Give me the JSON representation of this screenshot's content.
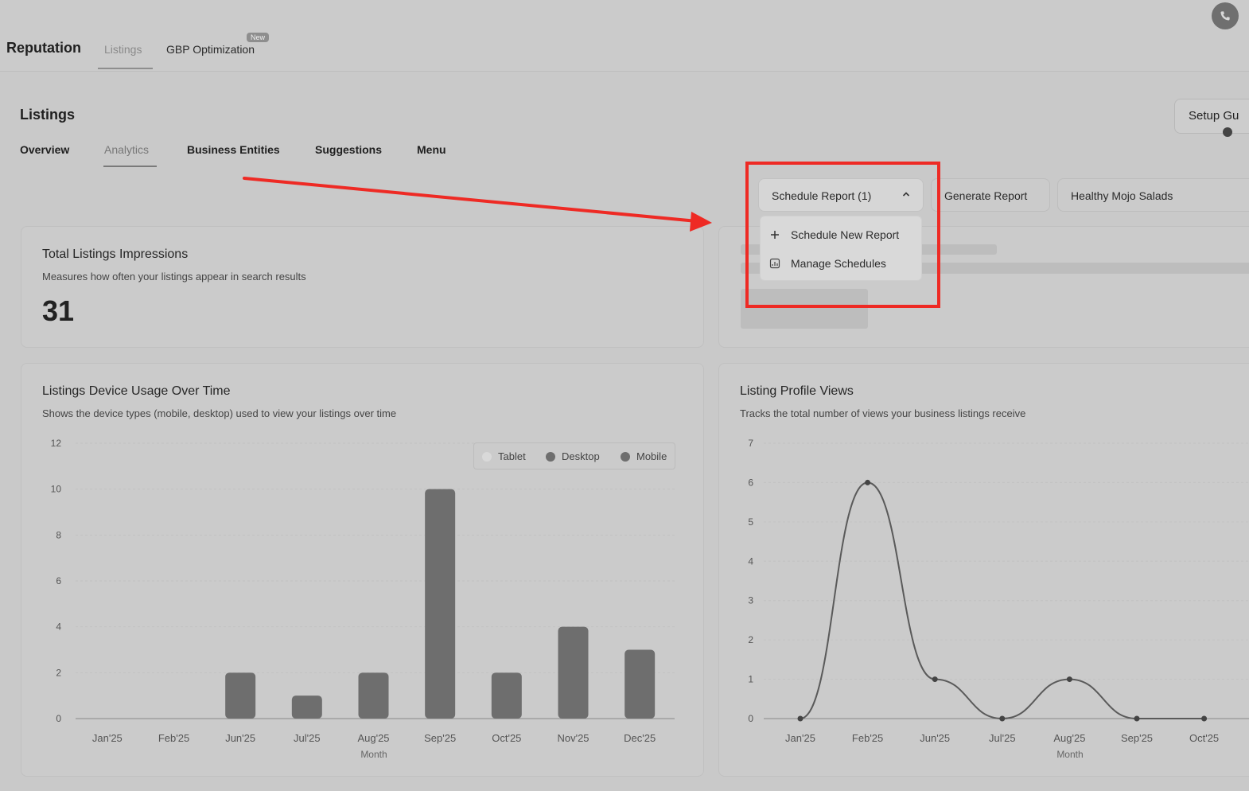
{
  "header": {
    "app_title": "Reputation",
    "tabs": [
      {
        "label": "Listings",
        "active": true
      },
      {
        "label": "GBP Optimization",
        "badge": "New"
      }
    ]
  },
  "page": {
    "title": "Listings",
    "setup_guide_label": "Setup Gu",
    "sub_tabs": [
      {
        "label": "Overview"
      },
      {
        "label": "Analytics",
        "active": true
      },
      {
        "label": "Business Entities"
      },
      {
        "label": "Suggestions"
      },
      {
        "label": "Menu"
      }
    ]
  },
  "toolbar": {
    "schedule_label": "Schedule Report (1)",
    "generate_label": "Generate Report",
    "location_value": "Healthy Mojo Salads"
  },
  "dropdown": {
    "items": [
      {
        "label": "Schedule New Report",
        "icon": "plus-icon"
      },
      {
        "label": "Manage Schedules",
        "icon": "calendar-report-icon"
      }
    ]
  },
  "impressions": {
    "title": "Total Listings Impressions",
    "subtitle": "Measures how often your listings appear in search results",
    "value": "31"
  },
  "colors": {
    "highlight": "#ee2a24",
    "bar": "#6e6e6e",
    "line": "#5a5a5a",
    "tablet": "#d9d9d9",
    "desktop": "#6e6e6e",
    "mobile": "#6e6e6e"
  },
  "chart_data": [
    {
      "type": "bar",
      "title": "Listings Device Usage Over Time",
      "subtitle": "Shows the device types (mobile, desktop) used to view your listings over time",
      "xlabel": "Month",
      "ylabel": "",
      "categories": [
        "Jan'25",
        "Feb'25",
        "Jun'25",
        "Jul'25",
        "Aug'25",
        "Sep'25",
        "Oct'25",
        "Nov'25",
        "Dec'25"
      ],
      "values": [
        0,
        0,
        2,
        1,
        2,
        10,
        2,
        4,
        3
      ],
      "legend": [
        "Tablet",
        "Desktop",
        "Mobile"
      ],
      "legend_position": "top-right",
      "ylim": [
        0,
        12
      ],
      "yticks": [
        "0",
        "2",
        "4",
        "6",
        "8",
        "10",
        "12"
      ],
      "grid": true
    },
    {
      "type": "line",
      "title": "Listing Profile Views",
      "subtitle": "Tracks the total number of views your business listings receive",
      "xlabel": "Month",
      "ylabel": "",
      "categories": [
        "Jan'25",
        "Feb'25",
        "Jun'25",
        "Jul'25",
        "Aug'25",
        "Sep'25",
        "Oct'25"
      ],
      "values": [
        0,
        6,
        1,
        0,
        1,
        0,
        0
      ],
      "ylim": [
        0,
        7
      ],
      "yticks": [
        "0",
        "1",
        "2",
        "3",
        "4",
        "5",
        "6",
        "7"
      ],
      "grid": true
    }
  ]
}
